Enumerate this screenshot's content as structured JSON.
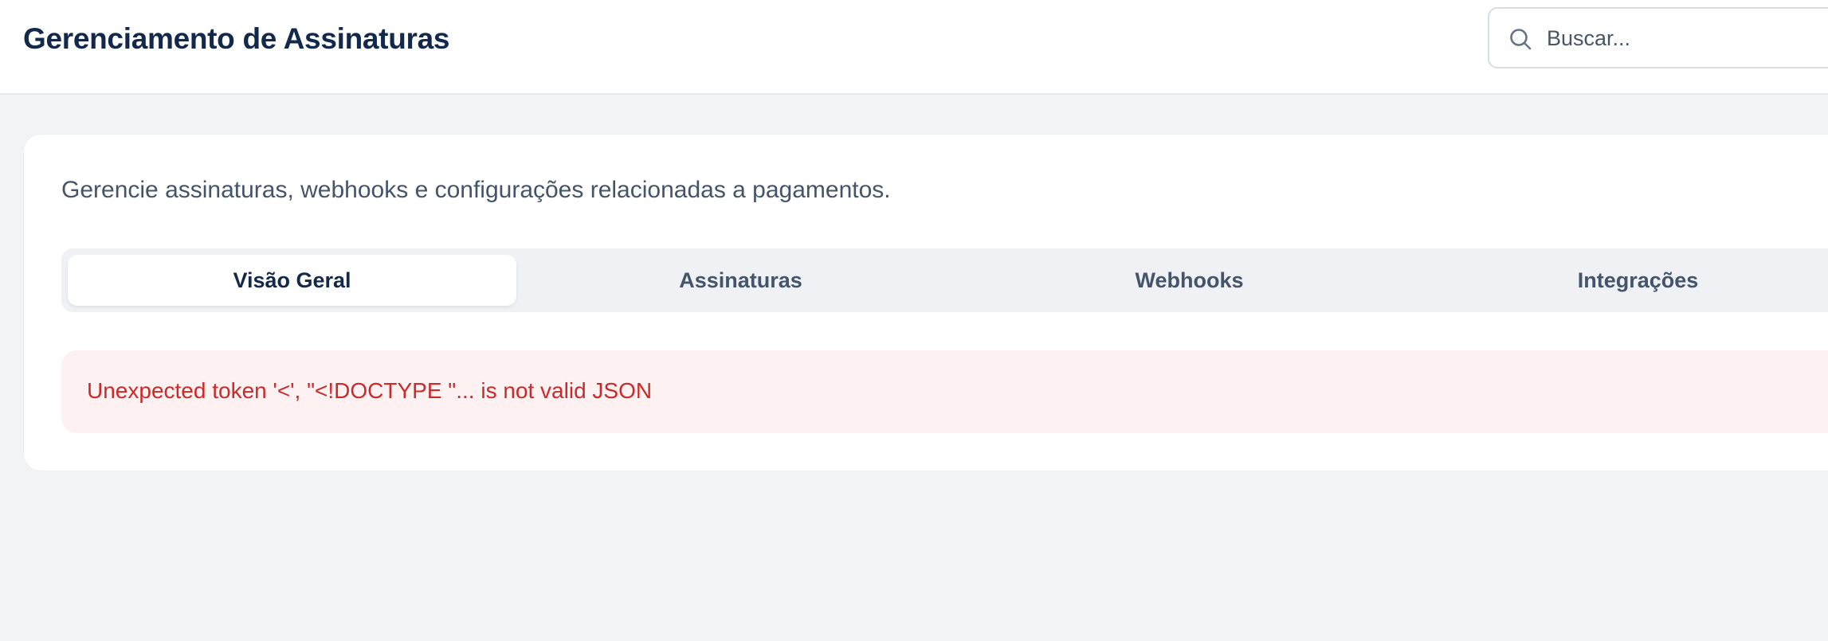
{
  "header": {
    "title": "Gerenciamento de Assinaturas",
    "search": {
      "icon": "search-icon",
      "placeholder": "Buscar...",
      "value": ""
    }
  },
  "main": {
    "description": "Gerencie assinaturas, webhooks e configurações relacionadas a pagamentos.",
    "tabs": [
      {
        "label": "Visão Geral",
        "active": true
      },
      {
        "label": "Assinaturas",
        "active": false
      },
      {
        "label": "Webhooks",
        "active": false
      },
      {
        "label": "Integrações",
        "active": false
      }
    ],
    "error": {
      "message": "Unexpected token '<', \"<!DOCTYPE \"... is not valid JSON"
    }
  },
  "colors": {
    "title": "#13294b",
    "page_background": "#f2f3f5",
    "error_text": "#cc2a2a",
    "error_background": "#fdf1f1"
  }
}
